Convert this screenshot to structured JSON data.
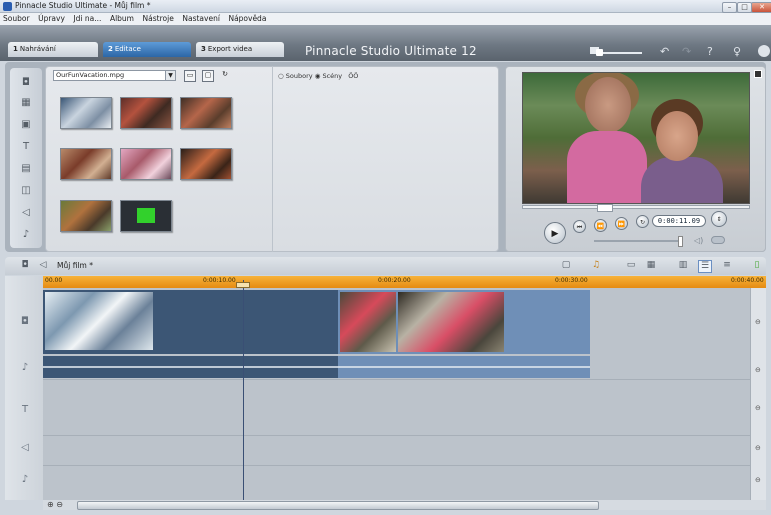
{
  "window": {
    "title": "Pinnacle Studio Ultimate - Můj film *",
    "minimize": "–",
    "maximize": "□",
    "close": "✕"
  },
  "menu": [
    "Soubor",
    "Úpravy",
    "Jdi na...",
    "Album",
    "Nástroje",
    "Nastavení",
    "Nápověda"
  ],
  "tabs": [
    {
      "num": "1",
      "label": "Nahrávání"
    },
    {
      "num": "2",
      "label": "Editace"
    },
    {
      "num": "3",
      "label": "Export videa"
    }
  ],
  "app_title": "Pinnacle Studio Ultimate 12",
  "header_icons": {
    "undo": "↶",
    "redo": "↷",
    "help": "?",
    "tip": "♀"
  },
  "album": {
    "file_combo": "OurFunVacation.mpg",
    "view_options": {
      "files": "Soubory",
      "scenes": "Scény",
      "scenes_selected": true,
      "extra": "ÖÖ"
    }
  },
  "left_icons": [
    "camera-icon",
    "film-icon",
    "photo-icon",
    "title-icon",
    "menu-icon",
    "transition-icon",
    "sound-icon",
    "music-icon"
  ],
  "preview": {
    "timecode": "0:00:11.09"
  },
  "timeline": {
    "title": "Můj film *",
    "ruler": [
      "00.00",
      "0:00:10.00",
      "0:00:20.00",
      "0:00:30.00",
      "0:00:40.00"
    ]
  },
  "colors": {
    "accent": "#2c66a6",
    "ruler": "#e58b12",
    "clip_dark": "#3c5675",
    "clip_light": "#6f8fb7"
  }
}
